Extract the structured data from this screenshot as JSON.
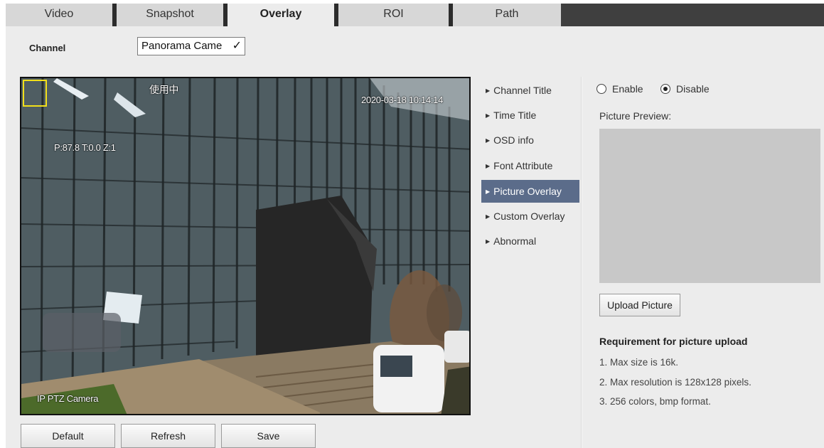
{
  "tabs": [
    {
      "label": "Video"
    },
    {
      "label": "Snapshot"
    },
    {
      "label": "Overlay",
      "active": true
    },
    {
      "label": "ROI"
    },
    {
      "label": "Path"
    }
  ],
  "channel": {
    "label": "Channel",
    "value": "Panorama Came"
  },
  "video": {
    "overlay_time": "2020-03-18 10:14:14",
    "overlay_ptz": "P:87.8 T:0.0 Z:1",
    "overlay_inuse": "使用中",
    "overlay_channel": "IP PTZ Camera"
  },
  "buttons": {
    "default": "Default",
    "refresh": "Refresh",
    "save": "Save"
  },
  "menu": [
    {
      "label": "Channel Title"
    },
    {
      "label": "Time Title"
    },
    {
      "label": "OSD info"
    },
    {
      "label": "Font Attribute"
    },
    {
      "label": "Picture Overlay",
      "active": true
    },
    {
      "label": "Custom Overlay"
    },
    {
      "label": "Abnormal"
    }
  ],
  "picture_overlay": {
    "enable_label": "Enable",
    "disable_label": "Disable",
    "selected": "Disable",
    "preview_label": "Picture Preview:",
    "upload_label": "Upload Picture",
    "requirement_title": "Requirement for picture upload",
    "requirements": [
      "1. Max size is 16k.",
      "2. Max resolution is 128x128 pixels.",
      "3. 256 colors, bmp format."
    ]
  },
  "colors": {
    "menu_active": "#5b6c8a",
    "tab_bar": "#3f3f3f",
    "selection_box": "#f2df1a"
  }
}
